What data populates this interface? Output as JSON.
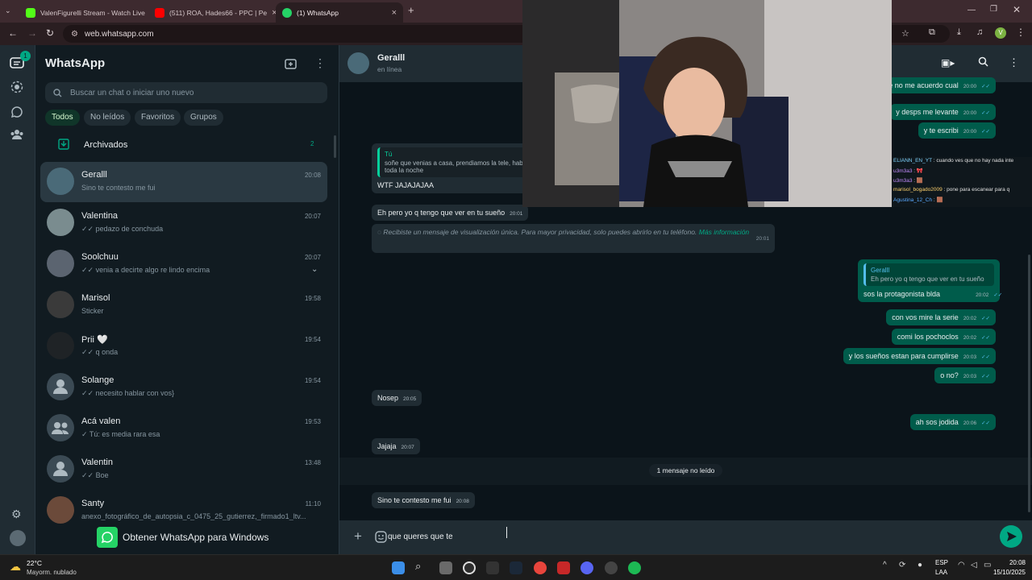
{
  "browser": {
    "tabs": [
      {
        "title": "ValenFigurelli Stream - Watch Live",
        "active": false
      },
      {
        "title": "(511) ROA, Hades66 - PPC | Pe",
        "active": false
      },
      {
        "title": "(1) WhatsApp",
        "active": true
      }
    ],
    "new_tab_glyph": "+",
    "url": "web.whatsapp.com",
    "profile_initial": "V"
  },
  "whatsapp": {
    "rail_badge": "1",
    "title": "WhatsApp",
    "search_placeholder": "Buscar un chat o iniciar uno nuevo",
    "filters": [
      "Todos",
      "No leídos",
      "Favoritos",
      "Grupos"
    ],
    "archived_label": "Archivados",
    "archived_count": "2",
    "chats": [
      {
        "name": "Geralll",
        "time": "20:08",
        "preview": "Sino te contesto me fui",
        "selected": true
      },
      {
        "name": "Valentina",
        "time": "20:07",
        "preview": "✓✓ pedazo de conchuda"
      },
      {
        "name": "Soolchuu",
        "time": "20:07",
        "preview": "✓✓ venia a decirte algo re lindo encima"
      },
      {
        "name": "Marisol",
        "time": "19:58",
        "preview": "Sticker"
      },
      {
        "name": "Prii 🤍",
        "time": "19:54",
        "preview": "✓✓ q onda"
      },
      {
        "name": "Solange",
        "time": "19:54",
        "preview": "✓✓ necesito hablar con vos}"
      },
      {
        "name": "Acá valen",
        "time": "19:53",
        "preview": "✓ Tú: es media rara esa"
      },
      {
        "name": "Valentin",
        "time": "13:48",
        "preview": "✓✓ Boe"
      },
      {
        "name": "Santy",
        "time": "11:10",
        "preview": "anexo_fotográfico_de_autopsia_c_0475_25_gutierrez,_firmado1_ltv..."
      }
    ],
    "get_app_label": "Obtener WhatsApp para Windows"
  },
  "conversation": {
    "contact_name": "Geralll",
    "contact_status": "en línea",
    "messages": [
      {
        "dir": "out",
        "text": "serie que no me acuerdo cual",
        "time": "20:00"
      },
      {
        "dir": "out",
        "text": "y desps me levante",
        "time": "20:00"
      },
      {
        "dir": "out",
        "text": "y te escribi",
        "time": "20:00"
      },
      {
        "dir": "in",
        "quote_name": "Tú",
        "quote_text_1": "soñe que venias a casa, prendiamos la tele, hablabamos",
        "quote_text_2": "toda la noche",
        "text": "WTF JAJAJAJAA",
        "time": ""
      },
      {
        "dir": "in",
        "text": "Eh pero yo q tengo que ver en tu sueño",
        "time": "20:01"
      },
      {
        "dir": "in",
        "text": "Recibiste un mensaje de visualización única. Para mayor privacidad, solo puedes abrirlo en tu teléfono.",
        "link": "Más información",
        "time": "20:01"
      },
      {
        "dir": "out",
        "quote_name": "Geralll",
        "quote_text_1": "Eh pero yo q tengo que ver en tu sueño",
        "text": "sos la protagonista blda",
        "time": "20:02"
      },
      {
        "dir": "out",
        "text": "con vos mire la serie",
        "time": "20:02"
      },
      {
        "dir": "out",
        "text": "comi los pochoclos",
        "time": "20:02"
      },
      {
        "dir": "out",
        "text": "y los sueños estan para cumplirse",
        "time": "20:03"
      },
      {
        "dir": "out",
        "text": "o no?",
        "time": "20:03"
      },
      {
        "dir": "in",
        "text": "Nosep",
        "time": "20:05"
      },
      {
        "dir": "out",
        "text": "ah sos jodida",
        "time": "20:06"
      },
      {
        "dir": "in",
        "text": "Jajaja",
        "time": "20:07"
      },
      {
        "dir": "in",
        "text": "Sino te contesto me fui",
        "time": "20:08"
      }
    ],
    "unread_divider": "1 mensaje no leído",
    "composer_text": "que queres que te"
  },
  "stream_chat": [
    {
      "user": "ELIANN_EN_YT",
      "msg": "cuando ves que no hay nada inte",
      "color": "#7fd4ff"
    },
    {
      "user": "u3m3a3",
      "msg": "🎀",
      "color": "#c48cff"
    },
    {
      "user": "u3m3a3",
      "msg": "🟫",
      "color": "#c48cff"
    },
    {
      "user": "marisol_bogado2009",
      "msg": "pone para escanear para q",
      "color": "#ffd36e"
    },
    {
      "user": "Agustina_12_Ch",
      "msg": "🟫",
      "color": "#5aa9ff"
    }
  ],
  "taskbar": {
    "weather_temp": "22°C",
    "weather_desc": "Mayorm. nublado",
    "lang_1": "ESP",
    "lang_2": "LAA",
    "time": "20:08",
    "date": "15/10/2025"
  },
  "colors": {
    "accent": "#00a884",
    "out_bubble": "#005c4b",
    "in_bubble": "#202c33"
  }
}
